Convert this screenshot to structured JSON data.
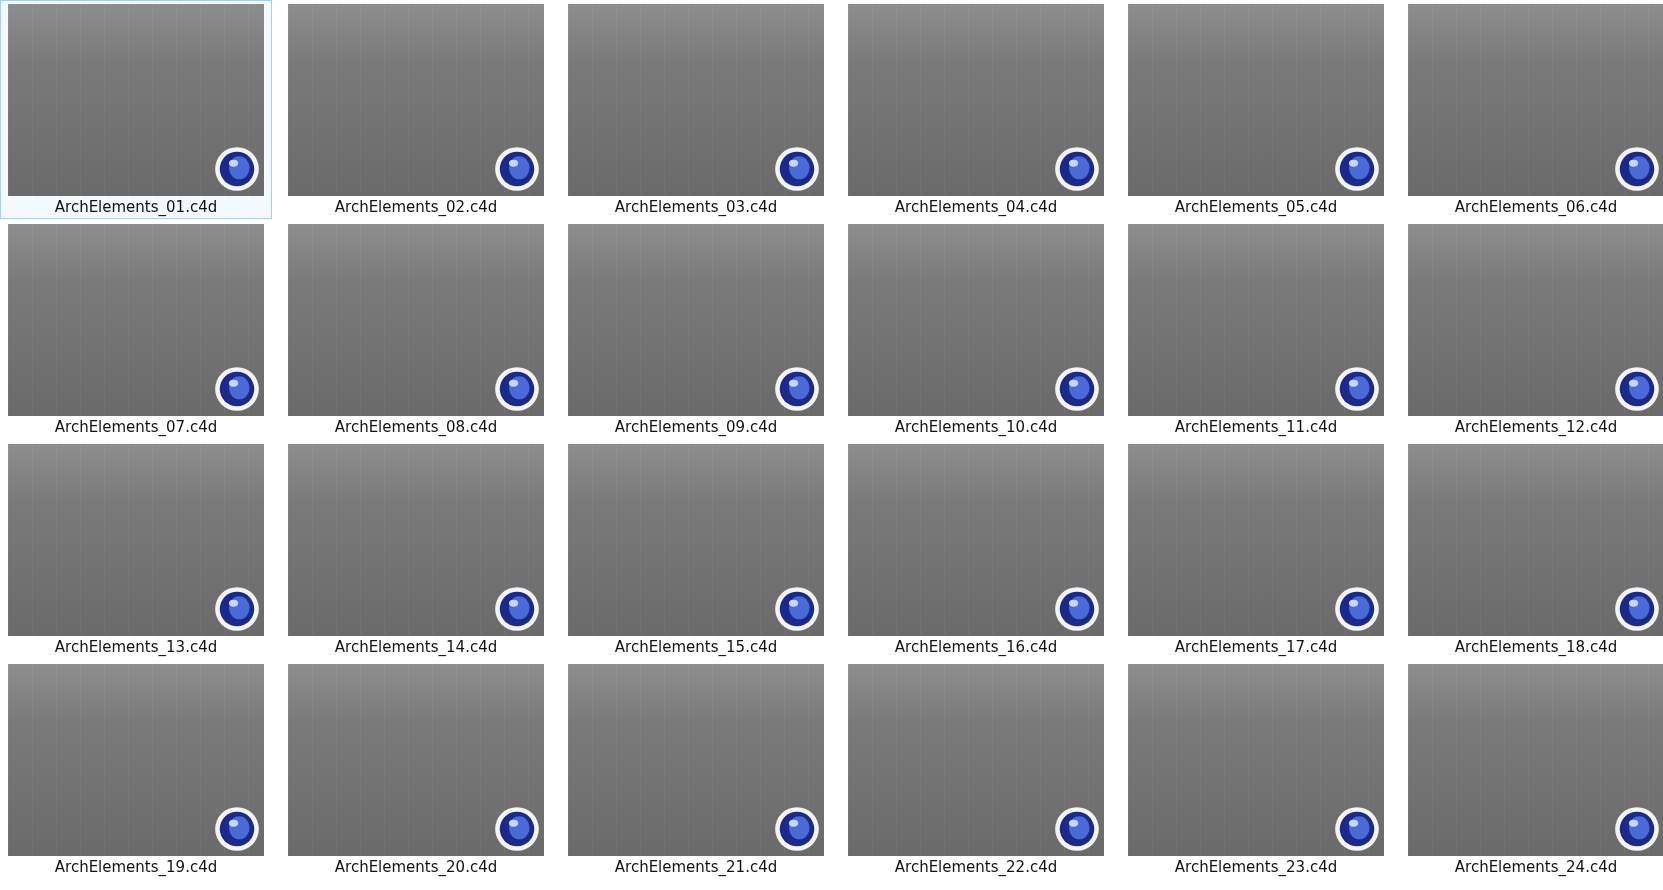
{
  "files": [
    {
      "name": "ArchElements_01.c4d",
      "selected": true
    },
    {
      "name": "ArchElements_02.c4d",
      "selected": false
    },
    {
      "name": "ArchElements_03.c4d",
      "selected": false
    },
    {
      "name": "ArchElements_04.c4d",
      "selected": false
    },
    {
      "name": "ArchElements_05.c4d",
      "selected": false
    },
    {
      "name": "ArchElements_06.c4d",
      "selected": false
    },
    {
      "name": "ArchElements_07.c4d",
      "selected": false
    },
    {
      "name": "ArchElements_08.c4d",
      "selected": false
    },
    {
      "name": "ArchElements_09.c4d",
      "selected": false
    },
    {
      "name": "ArchElements_10.c4d",
      "selected": false
    },
    {
      "name": "ArchElements_11.c4d",
      "selected": false
    },
    {
      "name": "ArchElements_12.c4d",
      "selected": false
    },
    {
      "name": "ArchElements_13.c4d",
      "selected": false
    },
    {
      "name": "ArchElements_14.c4d",
      "selected": false
    },
    {
      "name": "ArchElements_15.c4d",
      "selected": false
    },
    {
      "name": "ArchElements_16.c4d",
      "selected": false
    },
    {
      "name": "ArchElements_17.c4d",
      "selected": false
    },
    {
      "name": "ArchElements_18.c4d",
      "selected": false
    },
    {
      "name": "ArchElements_19.c4d",
      "selected": false
    },
    {
      "name": "ArchElements_20.c4d",
      "selected": false
    },
    {
      "name": "ArchElements_21.c4d",
      "selected": false
    },
    {
      "name": "ArchElements_22.c4d",
      "selected": false
    },
    {
      "name": "ArchElements_23.c4d",
      "selected": false
    },
    {
      "name": "ArchElements_24.c4d",
      "selected": false
    }
  ]
}
